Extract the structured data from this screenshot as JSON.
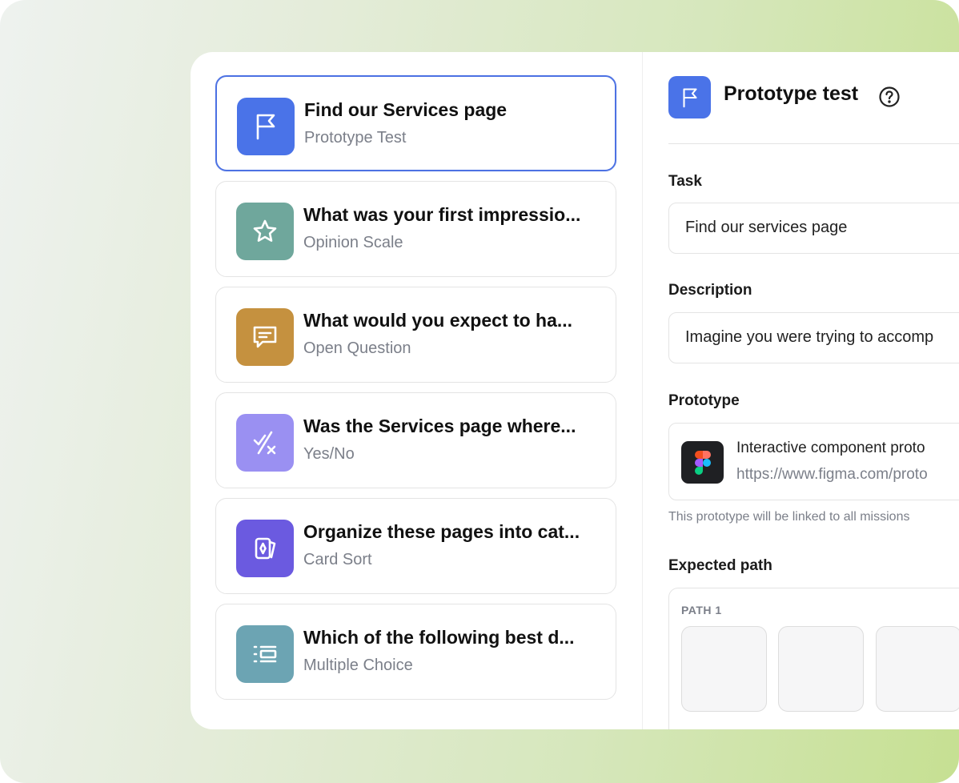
{
  "questions": [
    {
      "title": "Find our Services page",
      "type": "Prototype Test",
      "icon": "flag-icon",
      "color": "#4a73e8",
      "selected": true
    },
    {
      "title": "What was your first impressio...",
      "type": "Opinion Scale",
      "icon": "star-icon",
      "color": "#6fa79c"
    },
    {
      "title": "What would you expect to ha...",
      "type": "Open Question",
      "icon": "message-icon",
      "color": "#c5913f"
    },
    {
      "title": "Was the Services page where...",
      "type": "Yes/No",
      "icon": "check-x-icon",
      "color": "#9a90f2"
    },
    {
      "title": "Organize these pages into cat...",
      "type": "Card Sort",
      "icon": "card-sort-icon",
      "color": "#6b5ae0"
    },
    {
      "title": "Which of the following best d...",
      "type": "Multiple Choice",
      "icon": "list-icon",
      "color": "#6ca4b3"
    }
  ],
  "detail": {
    "title": "Prototype test",
    "task_label": "Task",
    "task_value": "Find our services page",
    "description_label": "Description",
    "description_value": "Imagine you were trying to accomp",
    "prototype_label": "Prototype",
    "prototype_name": "Interactive component proto",
    "prototype_url": "https://www.figma.com/proto",
    "prototype_hint": "This prototype will be linked to all missions",
    "expected_path_label": "Expected path",
    "path_label": "PATH 1"
  },
  "colors": {
    "accent": "#4a73e8",
    "selected_border": "#4d72e3",
    "background_gradient": [
      "#eef2ef",
      "#c6e092"
    ]
  }
}
